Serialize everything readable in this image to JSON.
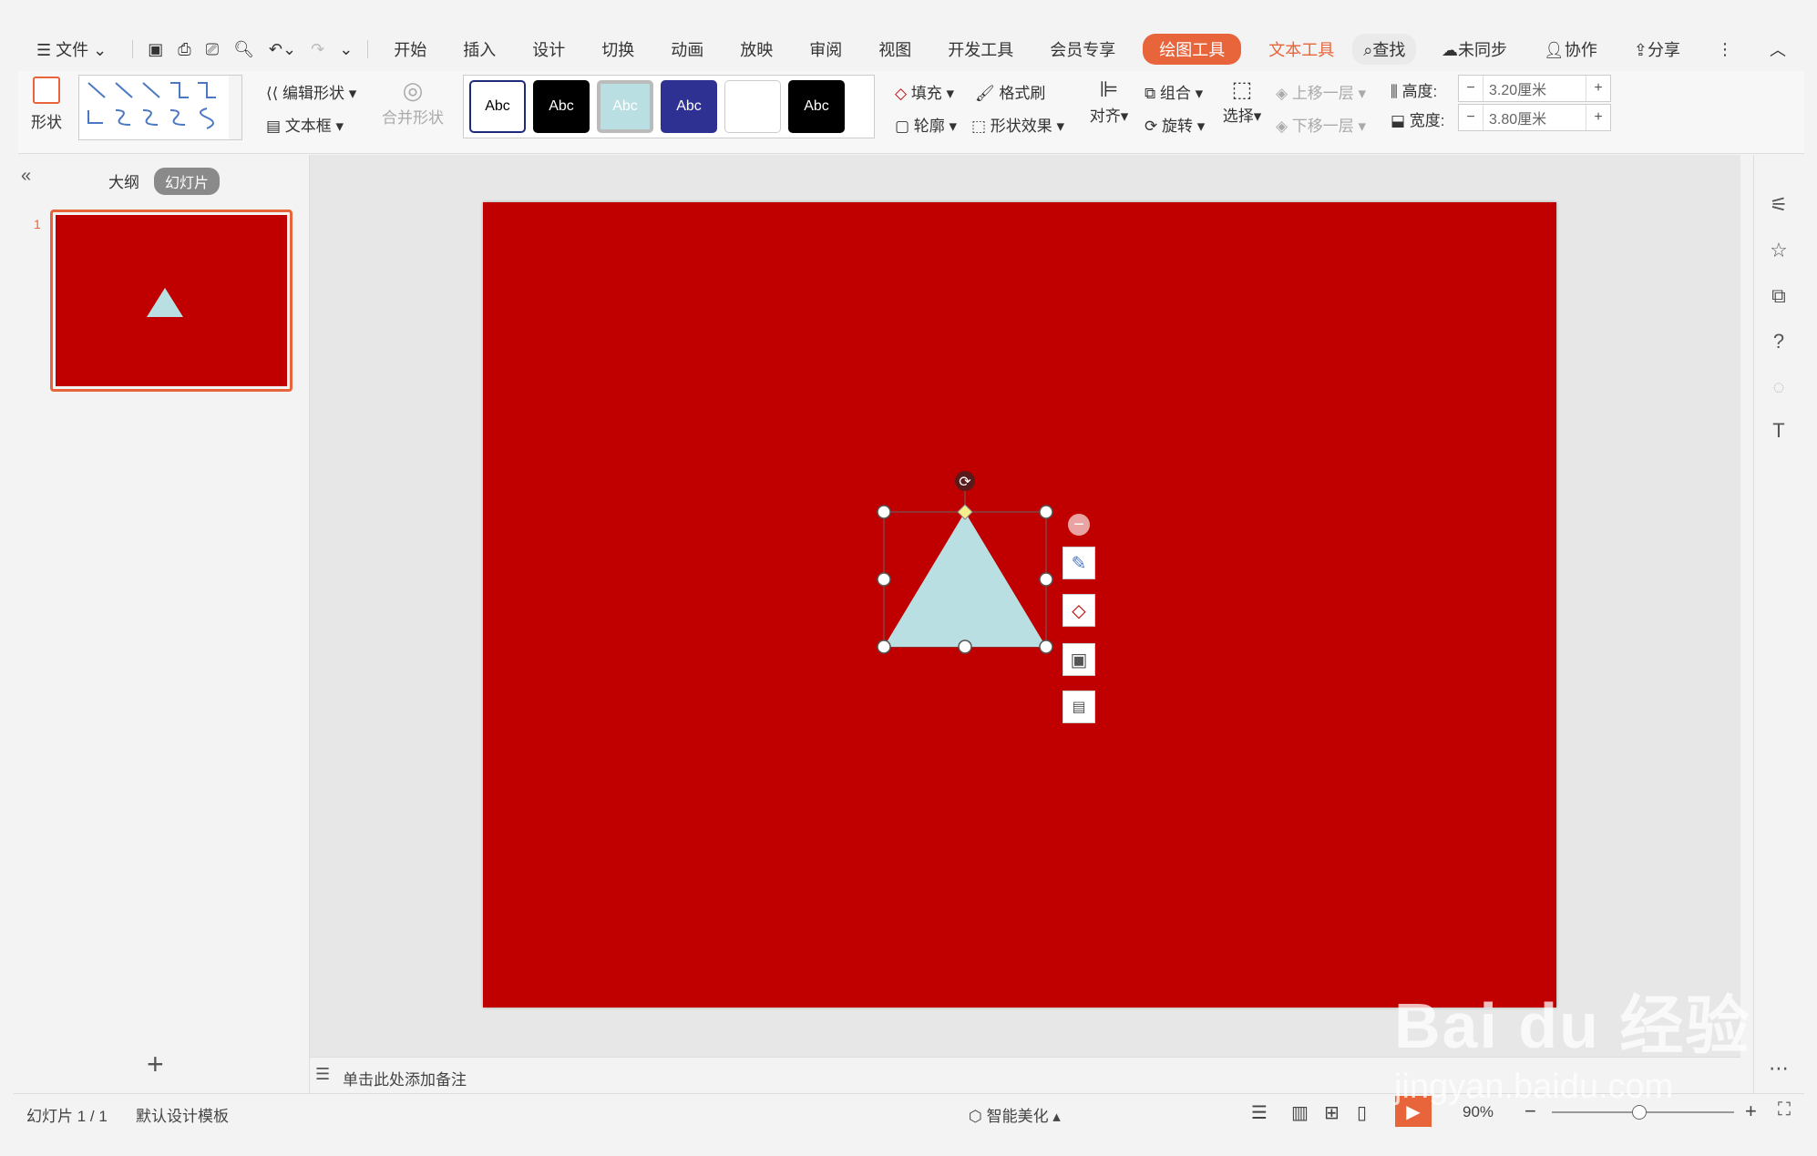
{
  "menu": {
    "hamburger_label": "文件",
    "tabs": [
      "开始",
      "插入",
      "设计",
      "切换",
      "动画",
      "放映",
      "审阅",
      "视图",
      "开发工具",
      "会员专享"
    ],
    "drawing_tools": "绘图工具",
    "text_tools": "文本工具",
    "search": "查找",
    "unsynced": "未同步",
    "collab": "协作",
    "share": "分享"
  },
  "ribbon": {
    "shape": "形状",
    "edit_shape": "编辑形状",
    "textbox": "文本框",
    "merge_shape": "合并形状",
    "styles": [
      "Abc",
      "Abc",
      "Abc",
      "Abc",
      "",
      "Abc"
    ],
    "fill": "填充",
    "format_painter": "格式刷",
    "outline": "轮廓",
    "shape_effects": "形状效果",
    "align": "对齐",
    "group": "组合",
    "rotate": "旋转",
    "select": "选择",
    "bring_forward": "上移一层",
    "send_backward": "下移一层",
    "height_label": "高度:",
    "height_value": "3.20厘米",
    "width_label": "宽度:",
    "width_value": "3.80厘米"
  },
  "left_panel": {
    "outline_tab": "大纲",
    "slides_tab": "幻灯片",
    "slide_number": "1",
    "add": "+"
  },
  "notes_placeholder": "单击此处添加备注",
  "status": {
    "slide_info": "幻灯片 1 / 1",
    "template": "默认设计模板",
    "smart_beautify": "智能美化",
    "zoom": "90%"
  },
  "colors": {
    "slide_bg": "#c00000",
    "triangle": "#b9dfe2",
    "accent": "#e8643a"
  },
  "watermark": {
    "brand": "Bai du 经验",
    "url": "jingyan.baidu.com"
  }
}
